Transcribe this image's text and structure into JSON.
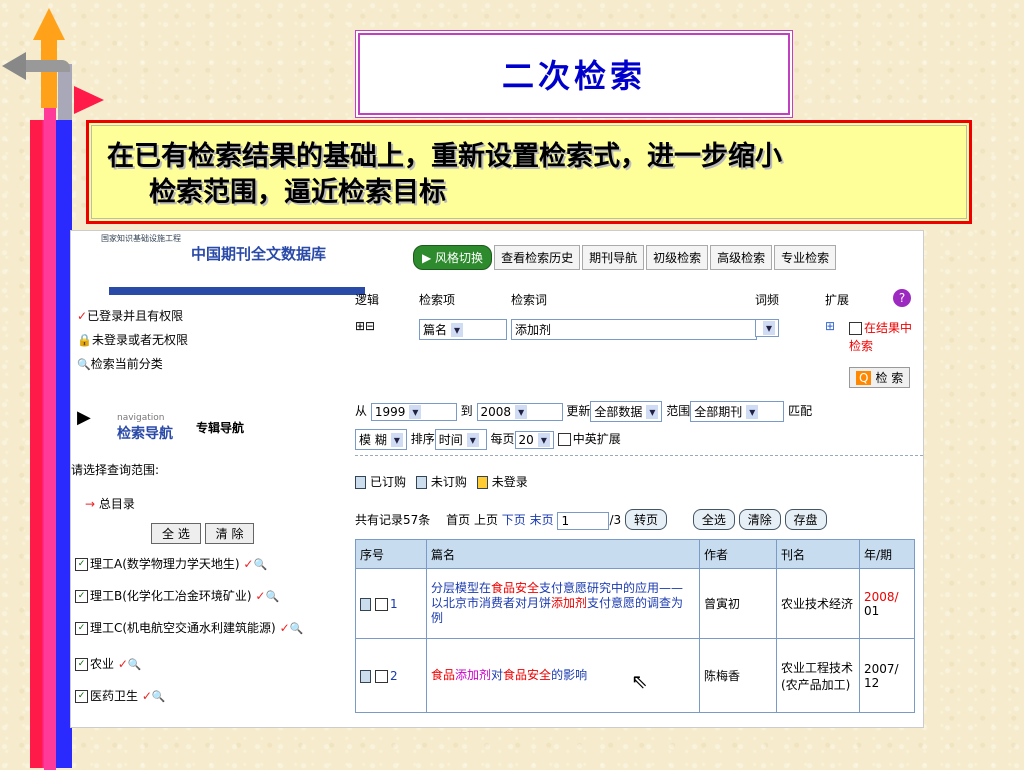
{
  "slide": {
    "title": "二次检索",
    "subtitle_line1": "在已有检索结果的基础上，重新设置检索式，进一步缩小",
    "subtitle_line2": "检索范围，逼近检索目标"
  },
  "app": {
    "db_title": "中国期刊全文数据库",
    "logo_text": "国家知识基础设施工程",
    "tabs": [
      "风格切换",
      "查看检索历史",
      "期刊导航",
      "初级检索",
      "高级检索",
      "专业检索"
    ]
  },
  "left": {
    "login_items": [
      "已登录并且有权限",
      "未登录或者无权限",
      "检索当前分类"
    ],
    "nav_label_small": "navigation",
    "nav_label": "检索导航",
    "journal_nav": "专辑导航",
    "scope_prompt": "请选择查询范围:",
    "root": "总目录",
    "select_all": "全 选",
    "clear": "清 除",
    "categories": [
      "理工A(数学物理力学天地生)",
      "理工B(化学化工冶金环境矿业)",
      "理工C(机电航空交通水利建筑能源)",
      "农业",
      "医药卫生"
    ]
  },
  "search": {
    "col_logic": "逻辑",
    "col_field": "检索项",
    "col_term": "检索词",
    "col_freq": "词频",
    "col_expand": "扩展",
    "logic_ops": "⊞⊟",
    "field_value": "篇名",
    "term_value": "添加剂",
    "in_results": "在结果中检索",
    "search_btn": "检 索",
    "from_label": "从",
    "from_year": "1999",
    "to_label": "到",
    "to_year": "2008",
    "update_label": "更新",
    "update_value": "全部数据",
    "range_label": "范围",
    "range_value": "全部期刊",
    "match_label": "匹配",
    "match_value": "模 糊",
    "sort_label": "排序",
    "sort_value": "时间",
    "per_page_label": "每页",
    "per_page_value": "20",
    "cn_en": "中英扩展"
  },
  "legend": [
    "已订购",
    "未订购",
    "未登录"
  ],
  "pager": {
    "total": "共有记录57条",
    "first": "首页",
    "prev": "上页",
    "next": "下页",
    "last": "末页",
    "page": "1",
    "of": "/3",
    "go": "转页",
    "select_all": "全选",
    "clear": "清除",
    "save": "存盘"
  },
  "table": {
    "headers": [
      "序号",
      "篇名",
      "作者",
      "刊名",
      "年/期"
    ],
    "rows": [
      {
        "no": "1",
        "title_parts": [
          "分层模型在",
          "食品安全",
          "支付意愿研究中的应用——以北京市消费者对月饼",
          "添加剂",
          "支付意愿的调查为例"
        ],
        "author": "曾寅初",
        "journal": "农业技术经济",
        "year": "2008/",
        "issue": "01"
      },
      {
        "no": "2",
        "title_parts": [
          "食品",
          "添加剂",
          "对",
          "食品安全",
          "的影响"
        ],
        "author": "陈梅香",
        "journal": "农业工程技术(农产品加工)",
        "year": "2007/",
        "issue": "12"
      }
    ]
  }
}
